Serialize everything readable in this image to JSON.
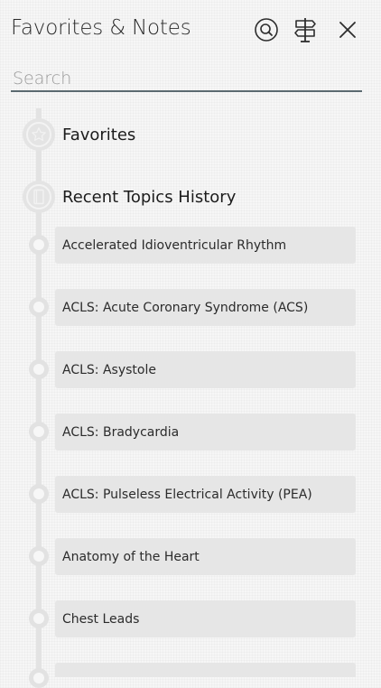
{
  "header": {
    "title": "Favorites & Notes",
    "icons": [
      "search-icon",
      "signpost-icon",
      "close-icon"
    ]
  },
  "search": {
    "placeholder": "Search",
    "value": ""
  },
  "sections": {
    "favorites": {
      "label": "Favorites",
      "icon": "star-icon"
    },
    "recent": {
      "label": "Recent Topics History",
      "icon": "book-icon"
    }
  },
  "recent_topics": [
    "Accelerated Idioventricular Rhythm",
    "ACLS: Acute Coronary Syndrome (ACS)",
    "ACLS: Asystole",
    "ACLS: Bradycardia",
    "ACLS: Pulseless Electrical Activity (PEA)",
    "Anatomy of the Heart",
    "Chest Leads"
  ],
  "colors": {
    "background": "#f6f6f6",
    "card": "#e6e6e6",
    "timeline": "#e3e3e3",
    "search_underline": "#5b6a70"
  }
}
